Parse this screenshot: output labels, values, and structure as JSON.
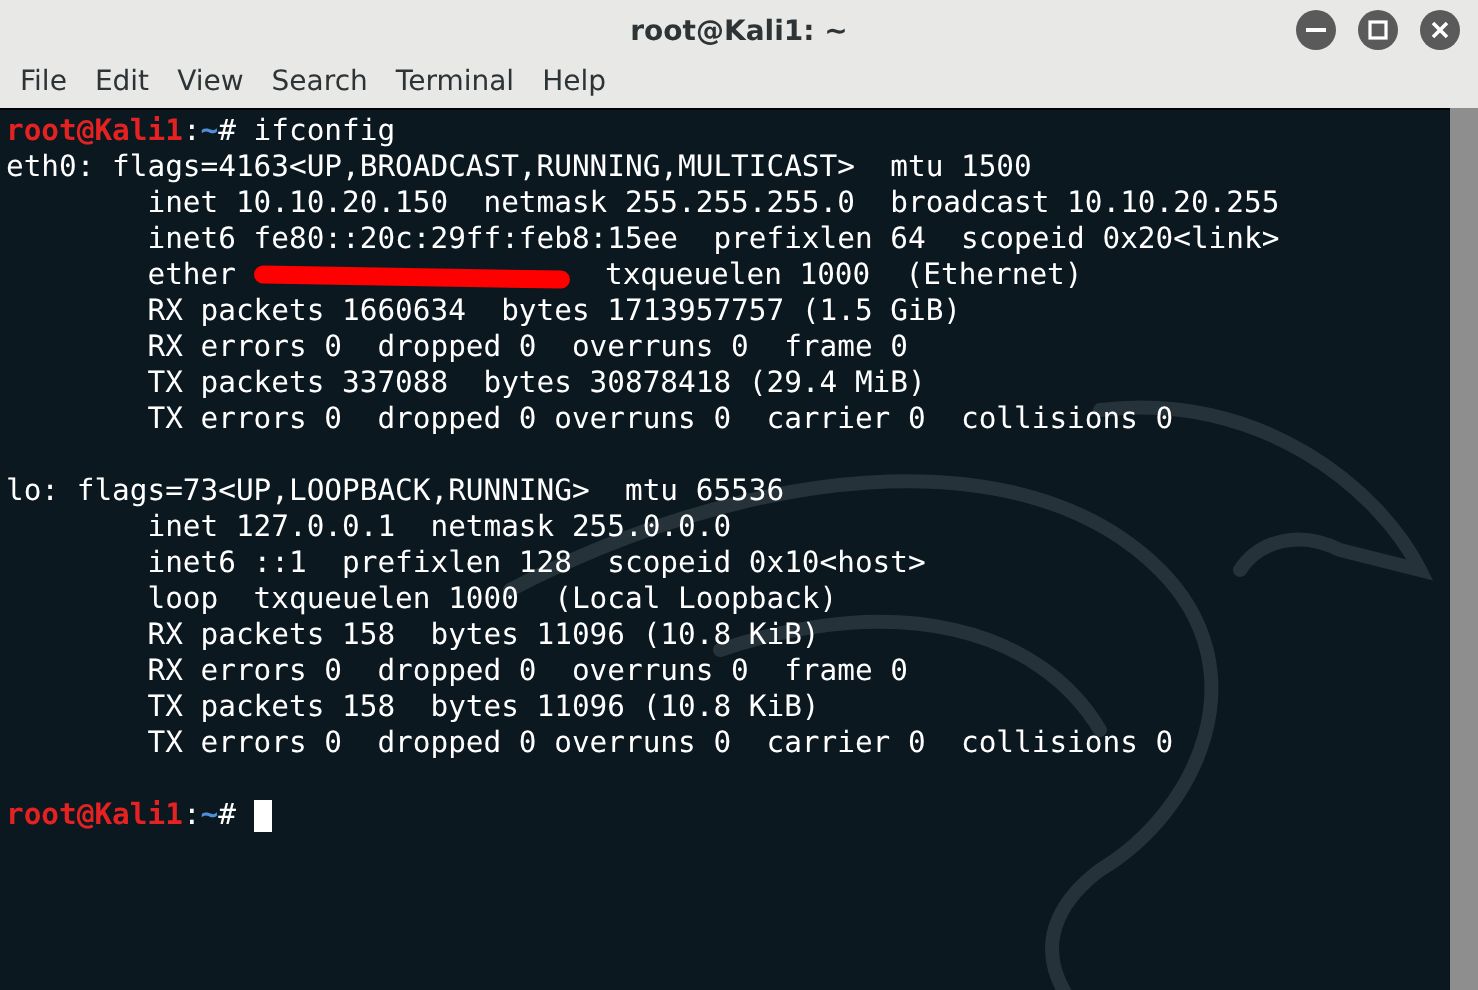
{
  "window": {
    "title": "root@Kali1: ~"
  },
  "menu": [
    "File",
    "Edit",
    "View",
    "Search",
    "Terminal",
    "Help"
  ],
  "terminal": {
    "lines": [
      {
        "kind": "prompt",
        "user": "root@Kali1",
        "separator": ":",
        "path": "~",
        "symbol": "#",
        "command": "ifconfig",
        "cursor": false
      },
      {
        "kind": "output",
        "segments": [
          {
            "kind": "text",
            "text": "eth0: flags=4163<UP,BROADCAST,RUNNING,MULTICAST>  mtu 1500"
          }
        ]
      },
      {
        "kind": "output",
        "segments": [
          {
            "kind": "text",
            "text": "        inet 10.10.20.150  netmask 255.255.255.0  broadcast 10.10.20.255"
          }
        ]
      },
      {
        "kind": "output",
        "segments": [
          {
            "kind": "text",
            "text": "        inet6 fe80::20c:29ff:feb8:15ee  prefixlen 64  scopeid 0x20<link>"
          }
        ]
      },
      {
        "kind": "output",
        "segments": [
          {
            "kind": "text",
            "text": "        ether "
          },
          {
            "kind": "redaction"
          },
          {
            "kind": "text",
            "text": "  txqueuelen 1000  (Ethernet)"
          }
        ]
      },
      {
        "kind": "output",
        "segments": [
          {
            "kind": "text",
            "text": "        RX packets 1660634  bytes 1713957757 (1.5 GiB)"
          }
        ]
      },
      {
        "kind": "output",
        "segments": [
          {
            "kind": "text",
            "text": "        RX errors 0  dropped 0  overruns 0  frame 0"
          }
        ]
      },
      {
        "kind": "output",
        "segments": [
          {
            "kind": "text",
            "text": "        TX packets 337088  bytes 30878418 (29.4 MiB)"
          }
        ]
      },
      {
        "kind": "output",
        "segments": [
          {
            "kind": "text",
            "text": "        TX errors 0  dropped 0 overruns 0  carrier 0  collisions 0"
          }
        ]
      },
      {
        "kind": "blank"
      },
      {
        "kind": "output",
        "segments": [
          {
            "kind": "text",
            "text": "lo: flags=73<UP,LOOPBACK,RUNNING>  mtu 65536"
          }
        ]
      },
      {
        "kind": "output",
        "segments": [
          {
            "kind": "text",
            "text": "        inet 127.0.0.1  netmask 255.0.0.0"
          }
        ]
      },
      {
        "kind": "output",
        "segments": [
          {
            "kind": "text",
            "text": "        inet6 ::1  prefixlen 128  scopeid 0x10<host>"
          }
        ]
      },
      {
        "kind": "output",
        "segments": [
          {
            "kind": "text",
            "text": "        loop  txqueuelen 1000  (Local Loopback)"
          }
        ]
      },
      {
        "kind": "output",
        "segments": [
          {
            "kind": "text",
            "text": "        RX packets 158  bytes 11096 (10.8 KiB)"
          }
        ]
      },
      {
        "kind": "output",
        "segments": [
          {
            "kind": "text",
            "text": "        RX errors 0  dropped 0  overruns 0  frame 0"
          }
        ]
      },
      {
        "kind": "output",
        "segments": [
          {
            "kind": "text",
            "text": "        TX packets 158  bytes 11096 (10.8 KiB)"
          }
        ]
      },
      {
        "kind": "output",
        "segments": [
          {
            "kind": "text",
            "text": "        TX errors 0  dropped 0 overruns 0  carrier 0  collisions 0"
          }
        ]
      },
      {
        "kind": "blank"
      },
      {
        "kind": "prompt",
        "user": "root@Kali1",
        "separator": ":",
        "path": "~",
        "symbol": "#",
        "cursor": true
      }
    ]
  }
}
